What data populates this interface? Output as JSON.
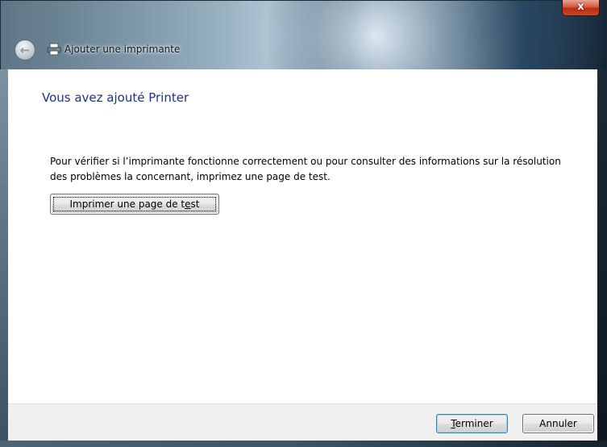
{
  "window": {
    "title": "Ajouter une imprimante",
    "close_label": "x"
  },
  "icons": {
    "back": "back-arrow-icon",
    "printer": "printer-icon",
    "close": "close-icon"
  },
  "content": {
    "heading": "Vous avez ajouté Printer",
    "description": "Pour vérifier si l’imprimante fonctionne correctement ou pour consulter des informations sur la résolution des problèmes la concernant, imprimez une page de test.",
    "test_button": {
      "before": "Imprimer une page de t",
      "accel": "e",
      "after": "st"
    }
  },
  "footer": {
    "finish_button": {
      "accel": "T",
      "after": "erminer"
    },
    "cancel_button": "Annuler"
  }
}
